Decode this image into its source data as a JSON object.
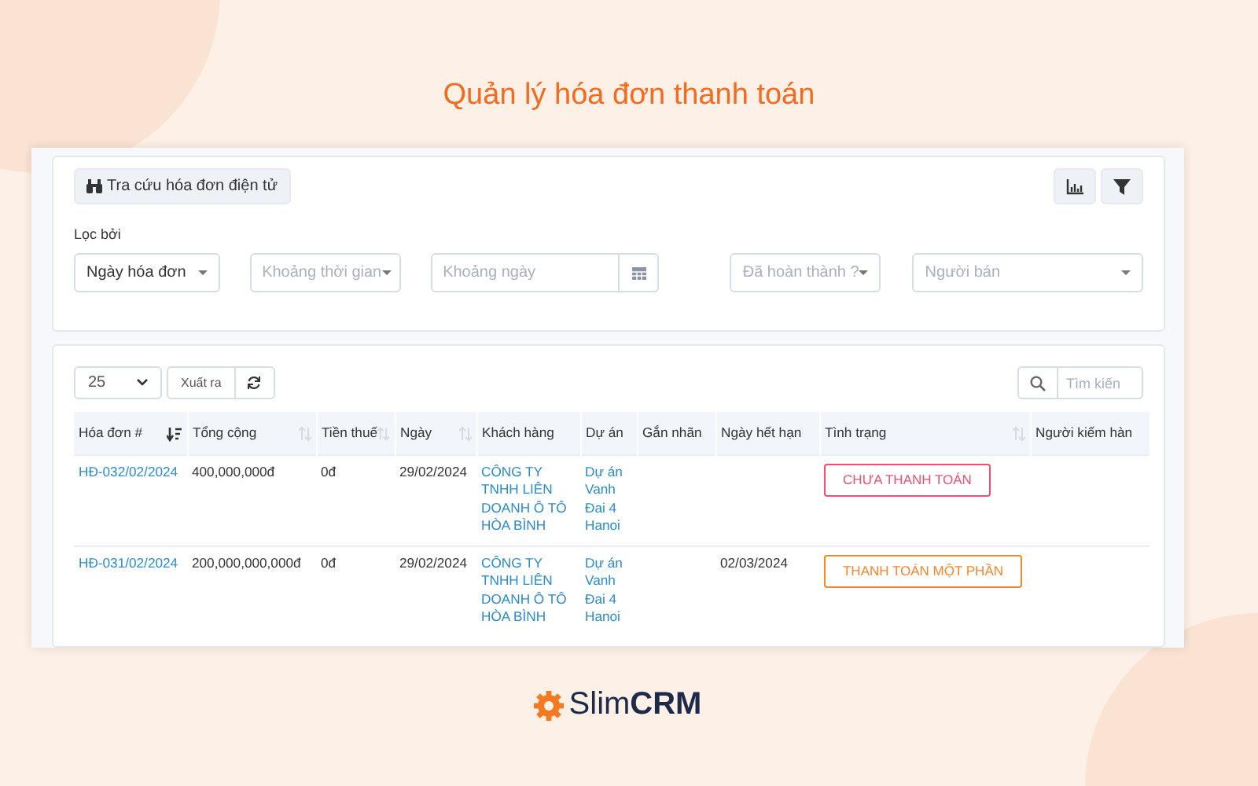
{
  "page_title": "Quản lý hóa đơn thanh toán",
  "toolbar": {
    "lookup_button": "Tra cứu hóa đơn điện tử"
  },
  "filters": {
    "label": "Lọc bởi",
    "fields": [
      {
        "kind": "select",
        "value": "Ngày hóa đơn"
      },
      {
        "kind": "select",
        "placeholder": "Khoảng thời gian"
      },
      {
        "kind": "date",
        "placeholder": "Khoảng ngày"
      },
      {
        "kind": "select",
        "placeholder": "Đã hoàn thành ?"
      },
      {
        "kind": "select",
        "placeholder": "Người bán"
      }
    ]
  },
  "table_controls": {
    "page_size": "25",
    "export_button": "Xuất ra",
    "search": {
      "placeholder": "Tìm kiến"
    }
  },
  "table": {
    "columns": [
      {
        "label": "Hóa đơn #",
        "sortable": true,
        "sorted": true
      },
      {
        "label": "Tổng cộng",
        "sortable": true,
        "sorted": false
      },
      {
        "label": "Tiền thuế",
        "sortable": true,
        "sorted": false
      },
      {
        "label": "Ngày",
        "sortable": true,
        "sorted": false
      },
      {
        "label": "Khách hàng",
        "sortable": false,
        "sorted": false
      },
      {
        "label": "Dự án",
        "sortable": false,
        "sorted": false
      },
      {
        "label": "Gắn nhãn",
        "sortable": false,
        "sorted": false
      },
      {
        "label": "Ngày hết hạn",
        "sortable": false,
        "sorted": false
      },
      {
        "label": "Tình trạng",
        "sortable": true,
        "sorted": false
      },
      {
        "label": "Người kiếm hàn",
        "sortable": false,
        "sorted": false
      }
    ],
    "rows": [
      {
        "invoice": "HĐ-032/02/2024",
        "total": "400,000,000đ",
        "tax": "0đ",
        "date": "29/02/2024",
        "customer": "CÔNG TY TNHH LIÊN DOANH Ô TÔ HÒA BÌNH",
        "project": "Dự án Vanh Đai 4 Hanoi",
        "status": {
          "label": "CHƯA THANH TOÁN",
          "color": "#f0506e"
        }
      },
      {
        "invoice": "HĐ-031/02/2024",
        "total": "200,000,000,000đ",
        "tax": "0đ",
        "date": "29/02/2024",
        "customer": "CÔNG TY TNHH LIÊN DOANH Ô TÔ HÒA BÌNH",
        "project": "Dự án Vanh Đai 4 Hanoi",
        "due": "02/03/2024",
        "status": {
          "label": "THANH TOÁN MỘT PHẦN",
          "color": "#f7862e"
        }
      }
    ]
  },
  "brand": {
    "name": "Slim**CRM**"
  }
}
